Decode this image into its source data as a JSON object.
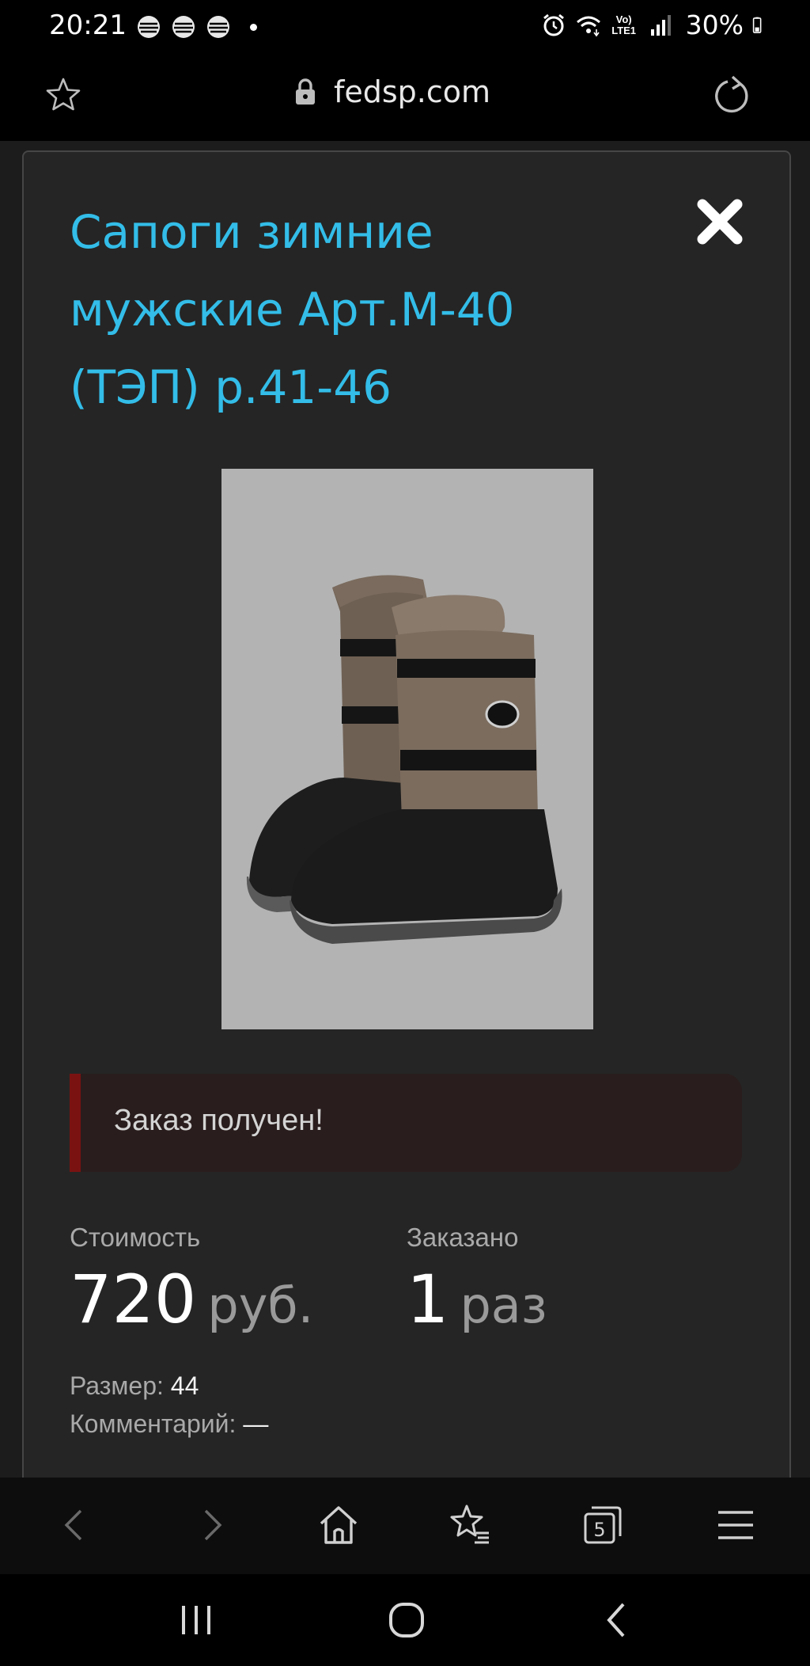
{
  "status_bar": {
    "time": "20:21",
    "network": "Vo) LTE1",
    "battery_percent": "30%"
  },
  "url_bar": {
    "url": "fedsp.com"
  },
  "modal": {
    "title": "Сапоги зимние мужские Арт.М-40 (ТЭП) р.41-46",
    "alert_text": "Заказ получен!",
    "price": {
      "label": "Стоимость",
      "value": "720",
      "unit": "руб."
    },
    "ordered": {
      "label": "Заказано",
      "value": "1",
      "unit": "раз"
    },
    "size_label": "Размер:",
    "size_value": "44",
    "comment_label": "Комментарий:",
    "comment_value": "—"
  },
  "toolbar": {
    "tabs_count": "5"
  },
  "colors": {
    "title": "#33bde8",
    "alert_accent": "#7a1212",
    "image_bg": "#b3b3b3"
  },
  "icons": {
    "status": [
      "sber-icon",
      "sber-icon",
      "sber-icon",
      "alarm-icon",
      "wifi-icon",
      "signal-icon",
      "battery-icon"
    ],
    "toolbar": [
      "back-arrow-icon",
      "forward-arrow-icon",
      "home-icon",
      "bookmarks-icon",
      "tabs-icon",
      "menu-icon"
    ],
    "system_nav": [
      "recent-apps-icon",
      "home-circle-icon",
      "back-chevron-icon"
    ]
  }
}
